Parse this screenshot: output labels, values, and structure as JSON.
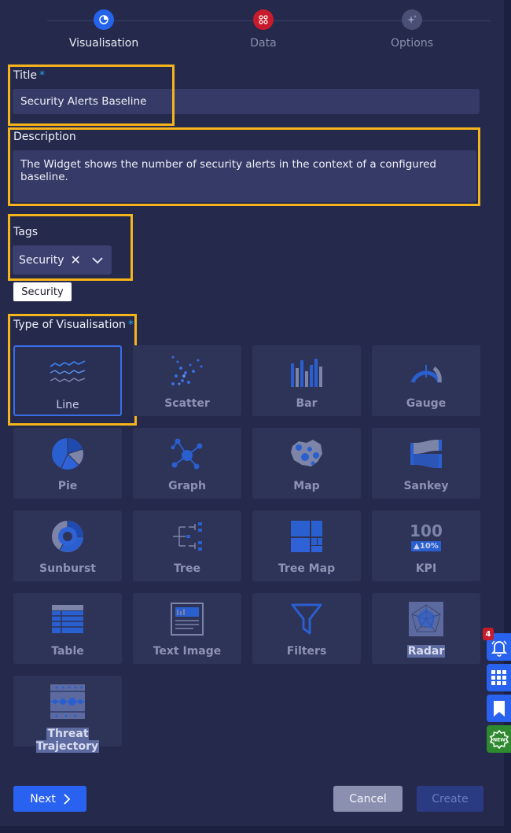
{
  "stepper": {
    "steps": [
      {
        "label": "Visualisation",
        "icon": "chart-pie-icon",
        "color": "#2563eb"
      },
      {
        "label": "Data",
        "icon": "dots-grid-icon",
        "color": "#c81c2c"
      },
      {
        "label": "Options",
        "icon": "sparkle-icon",
        "color": "#4a4f75"
      }
    ]
  },
  "form": {
    "title_label": "Title",
    "title_required_mark": "*",
    "title_value": "Security Alerts Baseline",
    "description_label": "Description",
    "description_value": "The Widget shows the number of security alerts in the context of  a configured baseline.",
    "tags_label": "Tags",
    "tags": [
      "Security"
    ],
    "tag_tooltip": "Security",
    "visualisation_label": "Type of Visualisation",
    "visualisation_required_mark": "*"
  },
  "visualisation_types": [
    {
      "label": "Line",
      "icon": "line-chart-icon",
      "selected": true
    },
    {
      "label": "Scatter",
      "icon": "scatter-chart-icon",
      "selected": false
    },
    {
      "label": "Bar",
      "icon": "bar-chart-icon",
      "selected": false
    },
    {
      "label": "Gauge",
      "icon": "gauge-icon",
      "selected": false
    },
    {
      "label": "Pie",
      "icon": "pie-chart-icon",
      "selected": false
    },
    {
      "label": "Graph",
      "icon": "network-graph-icon",
      "selected": false
    },
    {
      "label": "Map",
      "icon": "map-icon",
      "selected": false
    },
    {
      "label": "Sankey",
      "icon": "sankey-icon",
      "selected": false
    },
    {
      "label": "Sunburst",
      "icon": "sunburst-icon",
      "selected": false
    },
    {
      "label": "Tree",
      "icon": "tree-icon",
      "selected": false
    },
    {
      "label": "Tree Map",
      "icon": "treemap-icon",
      "selected": false
    },
    {
      "label": "KPI",
      "icon": "kpi-icon",
      "selected": false,
      "icon_text": "100",
      "icon_subtext": "▲10%"
    },
    {
      "label": "Table",
      "icon": "table-icon",
      "selected": false
    },
    {
      "label": "Text Image",
      "icon": "text-image-icon",
      "selected": false
    },
    {
      "label": "Filters",
      "icon": "filter-icon",
      "selected": false
    },
    {
      "label": "Radar",
      "icon": "radar-icon",
      "selected": false
    },
    {
      "label": "Threat Trajectory",
      "icon": "threat-trajectory-icon",
      "selected": false
    }
  ],
  "footer": {
    "next_label": "Next",
    "cancel_label": "Cancel",
    "create_label": "Create"
  },
  "side_toolbar": {
    "notification_count": "4",
    "items": [
      "bell-icon",
      "apps-grid-icon",
      "bookmark-icon",
      "new-badge-icon"
    ]
  },
  "colors": {
    "background": "#252a4c",
    "highlight": "#f5b41b",
    "primary": "#2962f0",
    "required": "#23a6e8"
  }
}
